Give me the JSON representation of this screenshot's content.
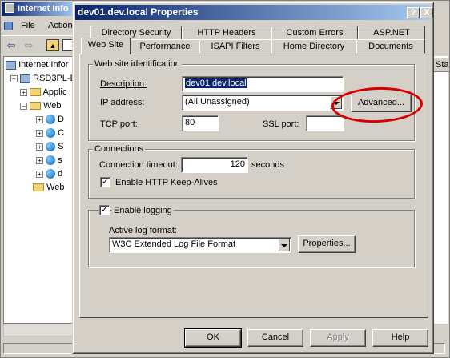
{
  "background_window": {
    "title": "Internet Info",
    "menu": [
      "File",
      "Action"
    ],
    "tree": [
      {
        "label": "Internet Infor"
      },
      {
        "label": "RSD3PL-D"
      },
      {
        "label": "Applic"
      },
      {
        "label": "Web"
      },
      {
        "label": "D"
      },
      {
        "label": "C"
      },
      {
        "label": "S"
      },
      {
        "label": "s"
      },
      {
        "label": "d"
      },
      {
        "label": "Web"
      }
    ],
    "right_column_header": "Sta"
  },
  "dialog": {
    "title": "dev01.dev.local Properties",
    "help_button": "?",
    "close_button": "X",
    "tabs_row1": [
      "Directory Security",
      "HTTP Headers",
      "Custom Errors",
      "ASP.NET"
    ],
    "tabs_row2": [
      "Web Site",
      "Performance",
      "ISAPI Filters",
      "Home Directory",
      "Documents"
    ],
    "active_tab": "Web Site",
    "identification": {
      "group_label": "Web site identification",
      "description_label": "Description:",
      "description_value": "dev01.dev.local",
      "ip_label": "IP address:",
      "ip_value": "(All Unassigned)",
      "advanced_button": "Advanced...",
      "tcp_label": "TCP port:",
      "tcp_value": "80",
      "ssl_label": "SSL port:",
      "ssl_value": ""
    },
    "connections": {
      "group_label": "Connections",
      "timeout_label": "Connection timeout:",
      "timeout_value": "120",
      "timeout_unit": "seconds",
      "keepalive_label": "Enable HTTP Keep-Alives",
      "keepalive_checked": true
    },
    "logging": {
      "enable_label": "Enable logging",
      "enable_checked": true,
      "format_label": "Active log format:",
      "format_value": "W3C Extended Log File Format",
      "properties_button": "Properties..."
    },
    "buttons": {
      "ok": "OK",
      "cancel": "Cancel",
      "apply": "Apply",
      "help": "Help"
    }
  },
  "annotation": {
    "color": "#d40000",
    "target": "Advanced..."
  }
}
